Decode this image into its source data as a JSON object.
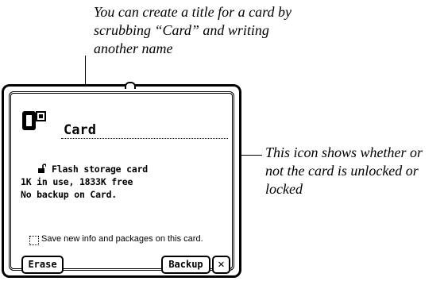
{
  "callouts": {
    "title_hint": "You can create a title for a card by scrubbing “Card” and writing another name",
    "lock_hint": "This icon shows whether or not the card is unlocked or locked"
  },
  "card": {
    "title": "Card",
    "storage_type": "Flash storage card",
    "usage": "1K in use, 1833K free",
    "backup_status": "No backup on Card."
  },
  "options": {
    "save_on_card_label": "Save new info and packages on this card.",
    "save_on_card_checked": false
  },
  "buttons": {
    "erase_label": "Erase",
    "backup_label": "Backup",
    "close_label": "✕"
  },
  "icons": {
    "card": "card-icon",
    "lock": "unlocked-icon",
    "close": "close-icon"
  }
}
